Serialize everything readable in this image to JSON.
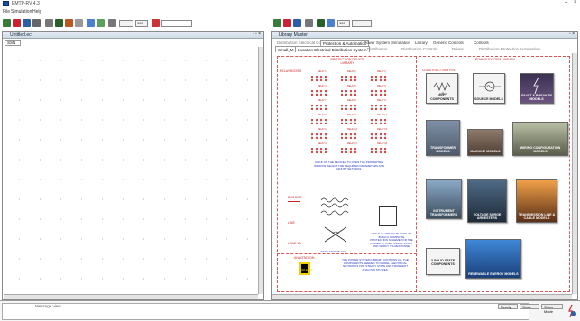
{
  "window": {
    "title": "EMTP-RV 4.3"
  },
  "menu": [
    "File",
    "Simulation",
    "Help"
  ],
  "zoom": {
    "left": "100",
    "right": "100"
  },
  "left_pane": {
    "title": "Untitled.ecf",
    "tab": "SSN"
  },
  "library": {
    "title": "Library Master",
    "tabs_row1": [
      "Distribution Electrical Components",
      "Protection & Automation",
      "Power System",
      "Simulation",
      "Library",
      "Generic Controls",
      "Controls"
    ],
    "tabs_row2": [
      "Small_M",
      "Location Electrical Distribution System",
      "Distribution",
      "Distribution Controls",
      "Drives",
      "Distribution Protection Automation"
    ],
    "section_labels": {
      "left_top": "PROTECTION DEVICE LIBRARY",
      "right_top": "POWER SYSTEM LIBRARY",
      "components_box": "CONSTRUCT/SIM RVL",
      "devices": "RELAY BOXES"
    },
    "thumbnails": [
      {
        "name": "RLC COMPONENTS"
      },
      {
        "name": "SOURCE MODELS"
      },
      {
        "name": "FAULT & BREAKER MODELS"
      },
      {
        "name": "TRANSFORMER MODELS"
      },
      {
        "name": "MACHINE MODELS"
      },
      {
        "name": "WIRING CONFIGURATION MODELS"
      },
      {
        "name": "INSTRUMENT TRANSFORMERS"
      },
      {
        "name": "VOLTAGE SURGE ARRESTERS"
      },
      {
        "name": "TRANSMISSION LINE & CABLE MODELS"
      },
      {
        "name": "3 SOLID STATE COMPONENTS"
      },
      {
        "name": "RENEWABLE ENERGY MODELS"
      }
    ],
    "relay_labels": [
      "RELAY 1",
      "RELAY 2",
      "RELAY 3",
      "RELAY 4",
      "RELAY 5",
      "RELAY 6",
      "RELAY 7",
      "RELAY 8",
      "RELAY 9",
      "RELAY 10",
      "RELAY 11",
      "RELAY 12",
      "RELAY 13",
      "RELAY 14",
      "RELAY 15",
      "RELAY 16",
      "RELAY 17",
      "RELAY 18"
    ],
    "side_labels": [
      "BUS BAR",
      "LINE",
      "LOAD 1A"
    ],
    "note_text": "CLICK ON THE DEVICES TO OPEN THE PROPERTIES WINDOW. SELECT THE REQUIRED PARAMETERS AND ADJUST SETTINGS.",
    "note_text2": "USE THE LIBRARY BLOCKS TO BUILD A COMPLETE PROTECTION SCHEME FOR THE POWER SYSTEM UNDER STUDY AND VERIFY ITS RESPONSE.",
    "note_text3": "THE POWER SYSTEM LIBRARY CONTAINS ALL THE COMPONENTS NEEDED TO MODEL ELECTRICAL NETWORKS FOR STEADY STATE AND TRANSIENT ANALYSIS STUDIES.",
    "yellow_box": "SIM-EMTP",
    "bottom_left_label": "ANNOTATION",
    "sim_box": "SIMULATION BLOCK"
  },
  "status": {
    "message": "Message view",
    "fields": [
      "Ready",
      "Scale",
      "Show Mode"
    ]
  }
}
